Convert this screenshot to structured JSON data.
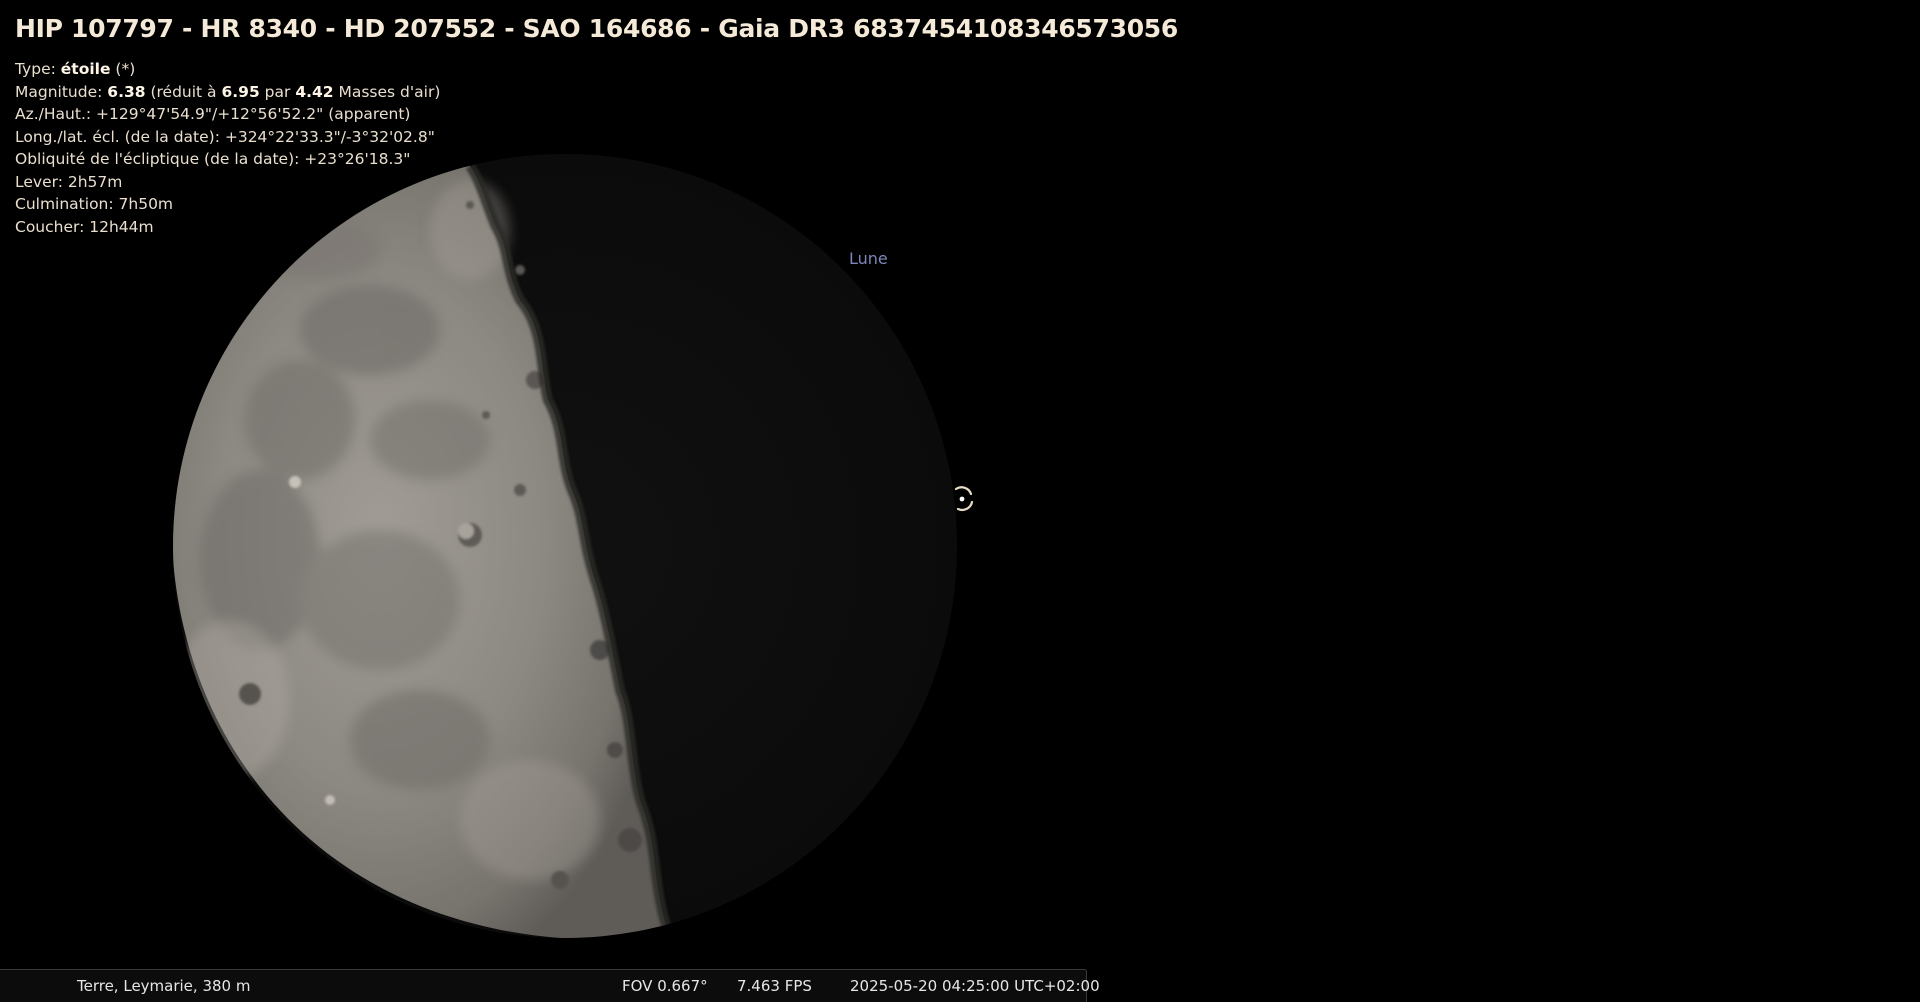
{
  "object": {
    "title": "HIP 107797 - HR 8340 - HD 207552 - SAO 164686 - Gaia DR3 6837454108346573056",
    "type_label": "Type: ",
    "type_value": "étoile",
    "type_suffix": " (*)",
    "magnitude_label": "Magnitude: ",
    "magnitude_value": "6.38",
    "magnitude_reduced_text": " (réduit à ",
    "magnitude_reduced_value": "6.95",
    "magnitude_par_text": " par ",
    "airmass_value": "4.42",
    "airmass_suffix": " Masses d'air)",
    "azalt": "Az./Haut.: +129°47'54.9\"/+12°56'52.2\" (apparent)",
    "ecliptic": "Long./lat. écl. (de la date): +324°22'33.3\"/-3°32'02.8\"",
    "obliquity": "Obliquité de l'écliptique (de la date): +23°26'18.3\"",
    "rise": "Lever: 2h57m",
    "transit": "Culmination: 7h50m",
    "set": "Coucher: 12h44m"
  },
  "sky": {
    "moon_label": "Lune",
    "moon_lit_color": "#8e8a84",
    "moon_dark_color": "#0e0e0e",
    "label_color": "#7c86b8",
    "marker_icon": "star-marker-icon"
  },
  "status_bar": {
    "location": "Terre, Leymarie, 380 m",
    "fov": "FOV 0.667°",
    "fps": "7.463 FPS",
    "datetime": "2025-05-20 04:25:00 UTC+02:00"
  }
}
